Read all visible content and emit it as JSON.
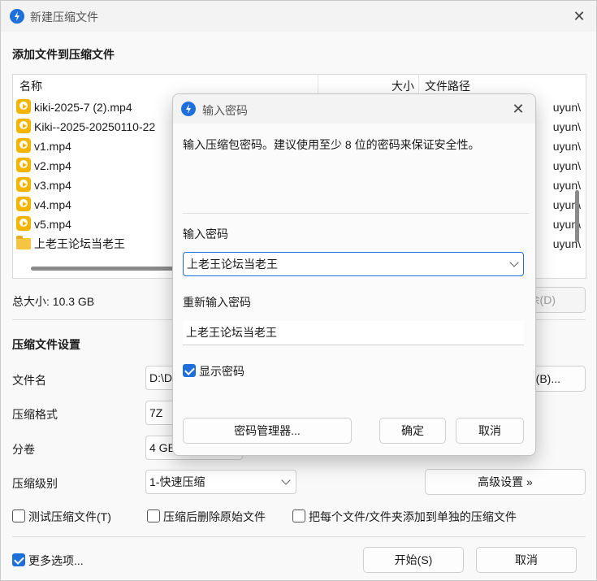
{
  "window": {
    "title": "新建压缩文件",
    "section_add": "添加文件到压缩文件"
  },
  "filelist": {
    "columns": {
      "name": "名称",
      "size": "大小",
      "path": "文件路径"
    },
    "rows": [
      {
        "name": "kiki-2025-7 (2).mp4",
        "type": "video",
        "path": "uyun\\"
      },
      {
        "name": "Kiki--2025-20250110-22",
        "type": "video",
        "path": "uyun\\"
      },
      {
        "name": "v1.mp4",
        "type": "video",
        "path": "uyun\\"
      },
      {
        "name": "v2.mp4",
        "type": "video",
        "path": "uyun\\"
      },
      {
        "name": "v3.mp4",
        "type": "video",
        "path": "uyun\\"
      },
      {
        "name": "v4.mp4",
        "type": "video",
        "path": "uyun\\"
      },
      {
        "name": "v5.mp4",
        "type": "video",
        "path": "uyun\\"
      },
      {
        "name": "上老王论坛当老王",
        "type": "folder",
        "path": "uyun\\"
      }
    ]
  },
  "total_size": "总大小: 10.3 GB",
  "delete_button_fragment": "余(D)",
  "settings": {
    "heading": "压缩文件设置",
    "filename_label": "文件名",
    "filename_value": "D:\\D",
    "browse_fragment": "(B)...",
    "format_label": "压缩格式",
    "format_value": "7Z",
    "volume_label": "分卷",
    "volume_value": "4 GB",
    "level_label": "压缩级别",
    "level_value": "1-快速压缩",
    "advanced_button": "高级设置 »"
  },
  "options": {
    "test_archive": "测试压缩文件(T)",
    "delete_after": "压缩后删除原始文件",
    "separate_archives": "把每个文件/文件夹添加到单独的压缩文件",
    "more_options": "更多选项..."
  },
  "footer": {
    "start_button": "开始(S)",
    "cancel_button": "取消"
  },
  "password_dialog": {
    "title": "输入密码",
    "description": "输入压缩包密码。建议使用至少 8 位的密码来保证安全性。",
    "password_label": "输入密码",
    "password_value": "上老王论坛当老王",
    "reenter_label": "重新输入密码",
    "reenter_value": "上老王论坛当老王",
    "show_password": "显示密码",
    "manager_button": "密码管理器...",
    "ok_button": "确定",
    "cancel_button": "取消"
  },
  "colors": {
    "accent": "#1e6fd9",
    "video_icon": "#f4b400",
    "folder_icon": "#f5c542"
  }
}
